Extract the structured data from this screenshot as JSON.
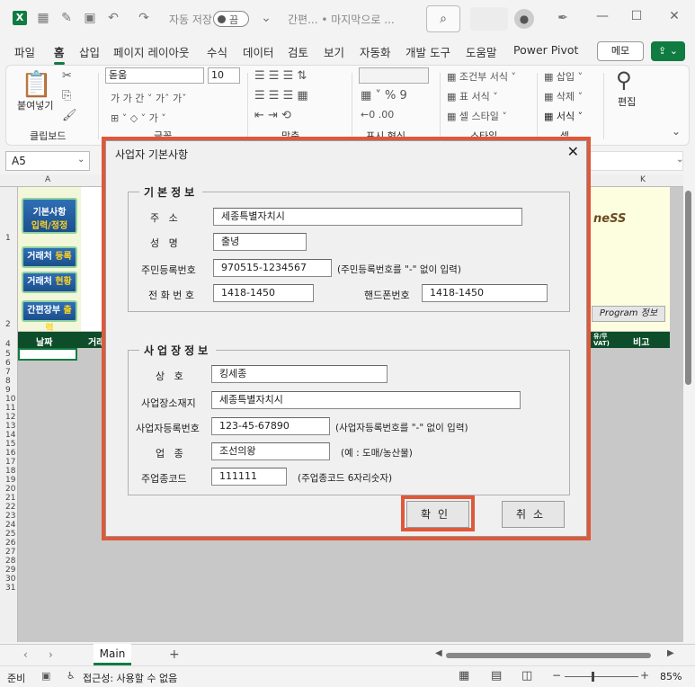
{
  "titlebar": {
    "excel_logo": "X",
    "autosave_label": "자동 저장",
    "autosave_state": "끔",
    "doc_title": "간편... • 마지막으로 ...",
    "minimize": "—",
    "maximize": "☐",
    "close": "✕"
  },
  "tabs": [
    "파일",
    "홈",
    "삽입",
    "페이지 레이아웃",
    "수식",
    "데이터",
    "검토",
    "보기",
    "자동화",
    "개발 도구",
    "도움말",
    "Power Pivot"
  ],
  "memo_label": "메모",
  "ribbon": {
    "paste_label": "붙여넣기",
    "clipboard_label": "클립보드",
    "font_name": "돋움",
    "font_size": "10",
    "font_label": "글꼴",
    "align_label": "맞춤",
    "number_label": "표시 형식",
    "cond_format": "조건부 서식",
    "table_format": "표 서식",
    "cell_style": "셀 스타일",
    "style_label": "스타일",
    "insert": "삽입",
    "delete": "삭제",
    "format": "서식",
    "cell_label": "셀",
    "edit_label": "편집"
  },
  "namebox": "A5",
  "sheet": {
    "col_a": "A",
    "col_k": "K",
    "side_buttons": [
      {
        "line1": "기본사항",
        "line2": "입력/정정"
      },
      {
        "text": "거래처 ",
        "hl": "등록"
      },
      {
        "text": "거래처 ",
        "hl": "현황"
      },
      {
        "text": "간편장부 ",
        "hl": "출력"
      }
    ],
    "logo_text": "neSS",
    "program_info": "Program 정보",
    "header_date": "날짜",
    "header_trade": "거래",
    "header_vat": "유/무 VAT)",
    "header_note": "비고",
    "row_numbers": [
      "1",
      "2",
      "4",
      "5",
      "6",
      "7",
      "8",
      "9",
      "10",
      "11",
      "12",
      "13",
      "14",
      "15",
      "16",
      "17",
      "18",
      "19",
      "20",
      "21",
      "22",
      "23",
      "24",
      "25",
      "26",
      "27",
      "28",
      "29",
      "30",
      "31"
    ]
  },
  "sheet_tab": "Main",
  "add_sheet": "+",
  "status": {
    "ready": "준비",
    "accessibility": "접근성: 사용할 수 없음",
    "zoom": "85%"
  },
  "dialog": {
    "title": "사업자 기본사항",
    "close": "✕",
    "basic_section": "기본정보",
    "address_label": "주   소",
    "address_value": "세종특별자치시",
    "name_label": "성   명",
    "name_value": "출녕",
    "rrn_label": "주민등록번호",
    "rrn_value": "970515-1234567",
    "rrn_hint": "(주민등록번호를 \"-\" 없이 입력)",
    "phone_label": "전 화 번 호",
    "phone_value": "1418-1450",
    "mobile_label": "핸드폰번호",
    "mobile_value": "1418-1450",
    "biz_section": "사업장정보",
    "company_label": "상   호",
    "company_value": "킹세종",
    "biz_addr_label": "사업장소재지",
    "biz_addr_value": "세종특별자치시",
    "brn_label": "사업자등록번호",
    "brn_value": "123-45-67890",
    "brn_hint": "(사업자등록번호를 \"-\" 없이 입력)",
    "biz_type_label": "업   종",
    "biz_type_value": "조선의왕",
    "biz_type_hint": "(예 : 도매/농산물)",
    "biz_code_label": "주업종코드",
    "biz_code_value": "111111",
    "biz_code_hint": "(주업종코드 6자리숫자)",
    "ok": "확인",
    "cancel": "취소"
  },
  "colors": {
    "accent": "#107c41",
    "highlight": "#e0583a"
  }
}
